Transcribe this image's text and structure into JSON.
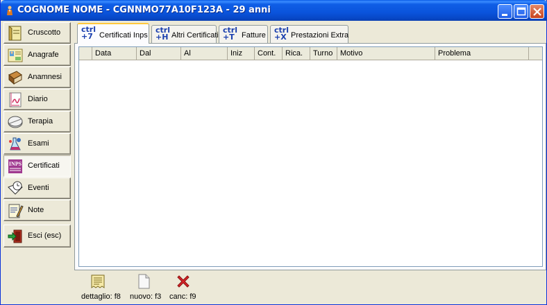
{
  "window": {
    "title": "COGNOME NOME - CGNNMO77A10F123A - 29 anni"
  },
  "sidebar": {
    "items": [
      {
        "label": "Cruscotto",
        "icon": "dashboard-icon"
      },
      {
        "label": "Anagrafe",
        "icon": "id-card-icon"
      },
      {
        "label": "Anamnesi",
        "icon": "book-icon"
      },
      {
        "label": "Diario",
        "icon": "journal-icon"
      },
      {
        "label": "Terapia",
        "icon": "pill-icon"
      },
      {
        "label": "Esami",
        "icon": "flask-icon"
      },
      {
        "label": "Certificati",
        "icon": "inps-icon"
      },
      {
        "label": "Eventi",
        "icon": "clock-book-icon"
      },
      {
        "label": "Note",
        "icon": "notepad-icon"
      },
      {
        "label": "Esci (esc)",
        "icon": "exit-icon"
      }
    ],
    "active": "Certificati"
  },
  "tabs": [
    {
      "shortcut_top": "ctrl",
      "shortcut_key": "+7",
      "label": "Certificati Inps",
      "active": true
    },
    {
      "shortcut_top": "ctrl",
      "shortcut_key": "+H",
      "label": "Altri Certificati",
      "active": false
    },
    {
      "shortcut_top": "ctrl",
      "shortcut_key": "+T",
      "label": "Fatture",
      "active": false
    },
    {
      "shortcut_top": "ctrl",
      "shortcut_key": "+X",
      "label": "Prestazioni Extra",
      "active": false
    }
  ],
  "grid": {
    "columns": [
      "Data",
      "Dal",
      "Al",
      "Iniz",
      "Cont.",
      "Rica.",
      "Turno",
      "Motivo",
      "Problema"
    ],
    "rows": []
  },
  "actions": [
    {
      "label": "dettaglio: f8",
      "icon": "detail-icon"
    },
    {
      "label": "nuovo: f3",
      "icon": "new-document-icon"
    },
    {
      "label": "canc: f9",
      "icon": "delete-icon"
    }
  ],
  "colors": {
    "titlebar": "#0a54dc",
    "window_bg": "#ece9d8",
    "tab_accent": "#ffc83c",
    "shortcut_text": "#1a3fae",
    "delete_red": "#d8262a"
  }
}
